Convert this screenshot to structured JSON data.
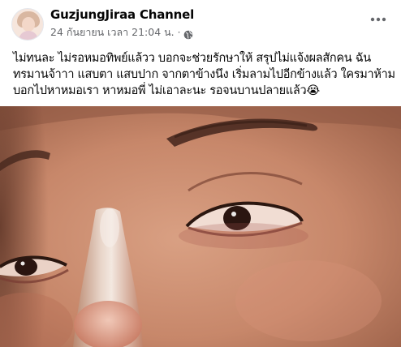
{
  "post": {
    "author": "GuzjungJiraa Channel",
    "timestamp": "24 กันยายน เวลา 21:04 น.",
    "separator": "·",
    "privacy_icon": "globe-icon",
    "menu_icon": "more-horizontal-icon",
    "text_lines": [
      "ไม่ทนละ ไม่รอหมอทิพย์แล้วว บอกจะช่วยรักษาให้ สรุปไม่แจ้งผลสักคน ฉัน",
      "ทรมานจ้าาา แสบตา แสบปาก จากตาข้างนึง เริ่มลามไปอีกข้างแล้ว ใครมาห้าม",
      "บอกไปหาหมอเรา หาหมอพี่ ไม่เอาละนะ รอจนบานปลายแล้ว😭"
    ]
  },
  "colors": {
    "text_primary": "#050505",
    "text_secondary": "#65676b",
    "background": "#ffffff"
  }
}
